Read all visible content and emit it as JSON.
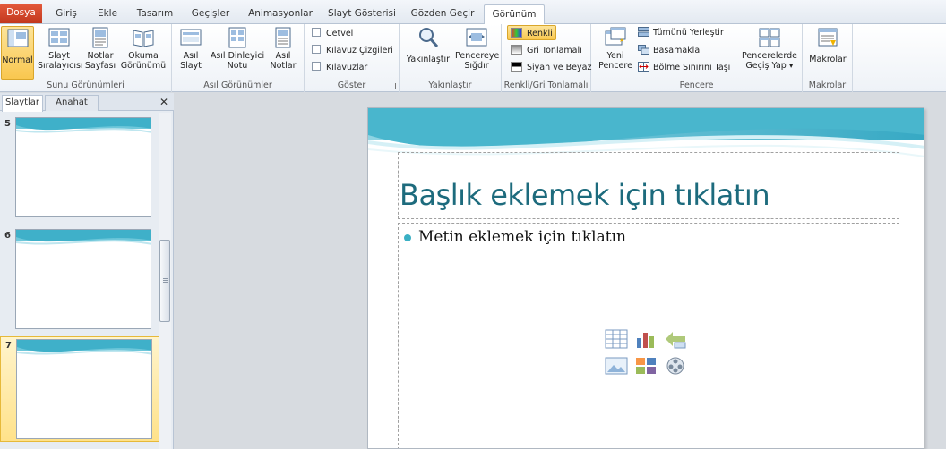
{
  "tabs": [
    "Dosya",
    "Giriş",
    "Ekle",
    "Tasarım",
    "Geçişler",
    "Animasyonlar",
    "Slayt Gösterisi",
    "Gözden Geçir",
    "Görünüm"
  ],
  "ribbon": {
    "presentation_views": {
      "label": "Sunu Görünümleri",
      "normal": "Normal",
      "slide_sorter_1": "Slayt",
      "slide_sorter_2": "Sıralayıcısı",
      "notes_page_1": "Notlar",
      "notes_page_2": "Sayfası",
      "reading_1": "Okuma",
      "reading_2": "Görünümü"
    },
    "master_views": {
      "label": "Asıl Görünümler",
      "slide_master_1": "Asıl",
      "slide_master_2": "Slayt",
      "handout_master_1": "Asıl Dinleyici",
      "handout_master_2": "Notu",
      "notes_master_1": "Asıl",
      "notes_master_2": "Notlar"
    },
    "show": {
      "label": "Göster",
      "ruler": "Cetvel",
      "gridlines": "Kılavuz Çizgileri",
      "guides": "Kılavuzlar"
    },
    "zoom": {
      "label": "Yakınlaştır",
      "zoom": "Yakınlaştır",
      "fit_1": "Pencereye",
      "fit_2": "Sığdır"
    },
    "color": {
      "label": "Renkli/Gri Tonlamalı",
      "color": "Renkli",
      "grayscale": "Gri Tonlamalı",
      "bw": "Siyah ve Beyaz"
    },
    "window": {
      "label": "Pencere",
      "new_1": "Yeni",
      "new_2": "Pencere",
      "arrange_all": "Tümünü Yerleştir",
      "cascade": "Basamakla",
      "move_split": "Bölme Sınırını Taşı",
      "switch_1": "Pencerelerde",
      "switch_2": "Geçiş Yap ▾"
    },
    "macros": {
      "label": "Makrolar",
      "macros": "Makrolar"
    }
  },
  "panel": {
    "tabs": [
      "Slaytlar",
      "Anahat"
    ],
    "close": "✕",
    "slides": [
      5,
      6,
      7
    ],
    "selected_slide": 7
  },
  "slide": {
    "title": "Başlık eklemek için tıklatın",
    "body": "Metin eklemek için tıklatın"
  },
  "colors": {
    "accent": "#1d6b7d",
    "file_tab": "#c2381e",
    "selected": "#f9c74f"
  }
}
